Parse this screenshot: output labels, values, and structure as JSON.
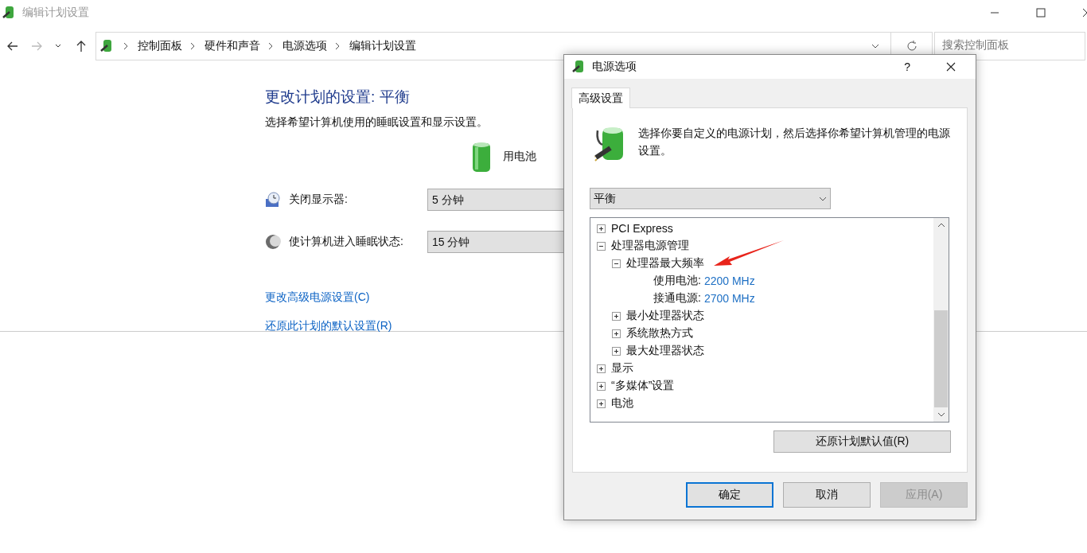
{
  "window": {
    "title": "编辑计划设置"
  },
  "breadcrumb": [
    "控制面板",
    "硬件和声音",
    "电源选项",
    "编辑计划设置"
  ],
  "search": {
    "placeholder": "搜索控制面板"
  },
  "plan": {
    "heading": "更改计划的设置: 平衡",
    "description": "选择希望计算机使用的睡眠设置和显示设置。",
    "column_header": "用电池",
    "settings": [
      {
        "kind": "display",
        "label": "关闭显示器:",
        "value": "5 分钟"
      },
      {
        "kind": "sleep",
        "label": "使计算机进入睡眠状态:",
        "value": "15 分钟"
      }
    ],
    "links": [
      "更改高级电源设置(C)",
      "还原此计划的默认设置(R)"
    ]
  },
  "dialog": {
    "title": "电源选项",
    "help": "?",
    "tabs": [
      {
        "label": "高级设置",
        "selected": true
      }
    ],
    "intro": "选择你要自定义的电源计划，然后选择你希望计算机管理的电源设置。",
    "plan_select": {
      "value": "平衡"
    },
    "tree": [
      {
        "kind": "group",
        "label": "PCI Express",
        "expanded": false
      },
      {
        "kind": "group",
        "label": "处理器电源管理",
        "expanded": true,
        "children": [
          {
            "kind": "group",
            "label": "处理器最大频率",
            "expanded": true,
            "children": [
              {
                "kind": "value",
                "label": "使用电池:",
                "value": "2200 MHz"
              },
              {
                "kind": "value",
                "label": "接通电源:",
                "value": "2700 MHz"
              }
            ]
          },
          {
            "kind": "group",
            "label": "最小处理器状态",
            "expanded": false
          },
          {
            "kind": "group",
            "label": "系统散热方式",
            "expanded": false
          },
          {
            "kind": "group",
            "label": "最大处理器状态",
            "expanded": false
          }
        ]
      },
      {
        "kind": "group",
        "label": "显示",
        "expanded": false
      },
      {
        "kind": "group",
        "label": "“多媒体”设置",
        "expanded": false
      },
      {
        "kind": "group",
        "label": "电池",
        "expanded": false
      }
    ],
    "restore_button": "还原计划默认值(R)",
    "buttons": [
      {
        "label": "确定",
        "default": true,
        "disabled": false
      },
      {
        "label": "取消",
        "default": false,
        "disabled": false
      },
      {
        "label": "应用(A)",
        "default": false,
        "disabled": true
      }
    ]
  }
}
